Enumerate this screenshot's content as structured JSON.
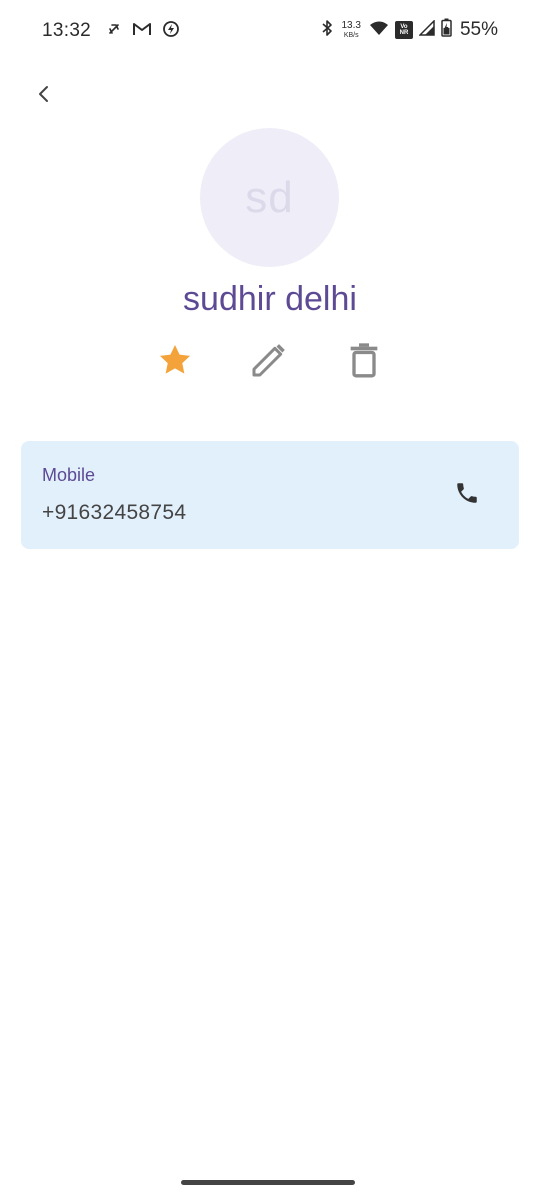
{
  "status_bar": {
    "time": "13:32",
    "left_icons": [
      "silent-icon",
      "gmail-icon",
      "data-saver-icon"
    ],
    "network_speed": "13.3",
    "network_speed_unit": "KB/s",
    "volte_top": "Vo",
    "volte_bottom": "NR",
    "right_icons": [
      "bluetooth-icon",
      "wifi-icon",
      "cellular-signal-icon",
      "battery-charging-icon"
    ],
    "battery_percent": "55%"
  },
  "header": {
    "back_icon": "chevron-left-icon"
  },
  "contact": {
    "initials": "sd",
    "name": "sudhir delhi",
    "actions": {
      "favorite_icon": "star-icon",
      "favorite_color": "#f3a33a",
      "edit_icon": "pencil-icon",
      "delete_icon": "trash-icon"
    },
    "phones": [
      {
        "label": "Mobile",
        "number": "+91632458754",
        "action_icon": "phone-icon"
      }
    ]
  },
  "colors": {
    "accent": "#5d4a94",
    "avatar_bg": "#efedf7",
    "card_bg": "#e2f0fc",
    "icon_gray": "#8a8a8a"
  }
}
